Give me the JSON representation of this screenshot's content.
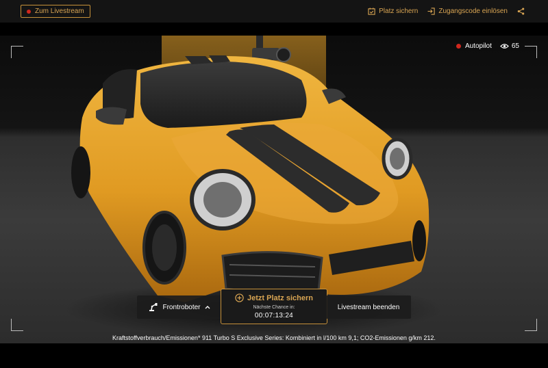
{
  "topbar": {
    "livestream_label": "Zum Livestream",
    "platz_label": "Platz sichern",
    "code_label": "Zugangscode einlösen",
    "icons": {
      "platz": "calendar-check-icon",
      "code": "login-icon",
      "share": "share-icon"
    }
  },
  "status": {
    "mode_label": "Autopilot",
    "viewer_count": "65",
    "icons": {
      "viewers": "eye-icon"
    }
  },
  "controls": {
    "robot_label": "Frontroboter",
    "cta_label": "Jetzt Platz sichern",
    "next_chance_label": "Nächste Chance in:",
    "countdown": "00:07:13:24",
    "end_label": "Livestream beenden",
    "icons": {
      "robot": "robot-arm-icon",
      "chevron": "chevron-up-icon",
      "cta": "plus-circle-icon"
    }
  },
  "footer": {
    "consumption_text": "Kraftstoffverbrauch/Emissionen* 911 Turbo S Exclusive Series: Kombiniert in l/100 km 9,1; CO2-Emissionen g/km 212."
  },
  "colors": {
    "accent": "#d9a553",
    "live_red": "#d0271d",
    "car_gold": "#e0a12a",
    "panel_bg": "#1c1c1c"
  }
}
